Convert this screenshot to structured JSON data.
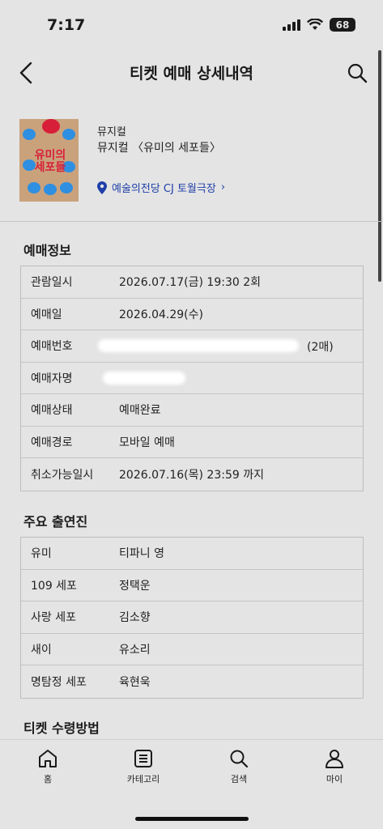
{
  "status_bar": {
    "time": "7:17",
    "battery": "68"
  },
  "header": {
    "title": "티켓 예매 상세내역"
  },
  "event": {
    "category": "뮤지컬",
    "title": "뮤지컬 〈유미의 세포들〉",
    "venue": "예술의전당 CJ 토월극장",
    "poster_title": "유미의\n세포들"
  },
  "booking_section": {
    "title": "예매정보",
    "rows": [
      {
        "label": "관람일시",
        "value": "2026.07.17(금) 19:30 2회"
      },
      {
        "label": "예매일",
        "value": "2026.04.29(수)"
      },
      {
        "label": "예매번호",
        "value": "(2매)"
      },
      {
        "label": "예매자명",
        "value": ""
      },
      {
        "label": "예매상태",
        "value": "예매완료"
      },
      {
        "label": "예매경로",
        "value": "모바일 예매"
      },
      {
        "label": "취소가능일시",
        "value": "2026.07.16(목) 23:59 까지"
      }
    ]
  },
  "cast_section": {
    "title": "주요 출연진",
    "rows": [
      {
        "label": "유미",
        "value": "티파니 영"
      },
      {
        "label": "109 세포",
        "value": "정택운"
      },
      {
        "label": "사랑 세포",
        "value": "김소향"
      },
      {
        "label": "새이",
        "value": "유소리"
      },
      {
        "label": "명탐정 세포",
        "value": "육현욱"
      }
    ]
  },
  "pickup_section": {
    "title": "티켓 수령방법"
  },
  "tab_bar": {
    "items": [
      {
        "label": "홈",
        "icon": "home-icon"
      },
      {
        "label": "카테고리",
        "icon": "list-icon"
      },
      {
        "label": "검색",
        "icon": "search-icon"
      },
      {
        "label": "마이",
        "icon": "person-icon"
      }
    ]
  }
}
